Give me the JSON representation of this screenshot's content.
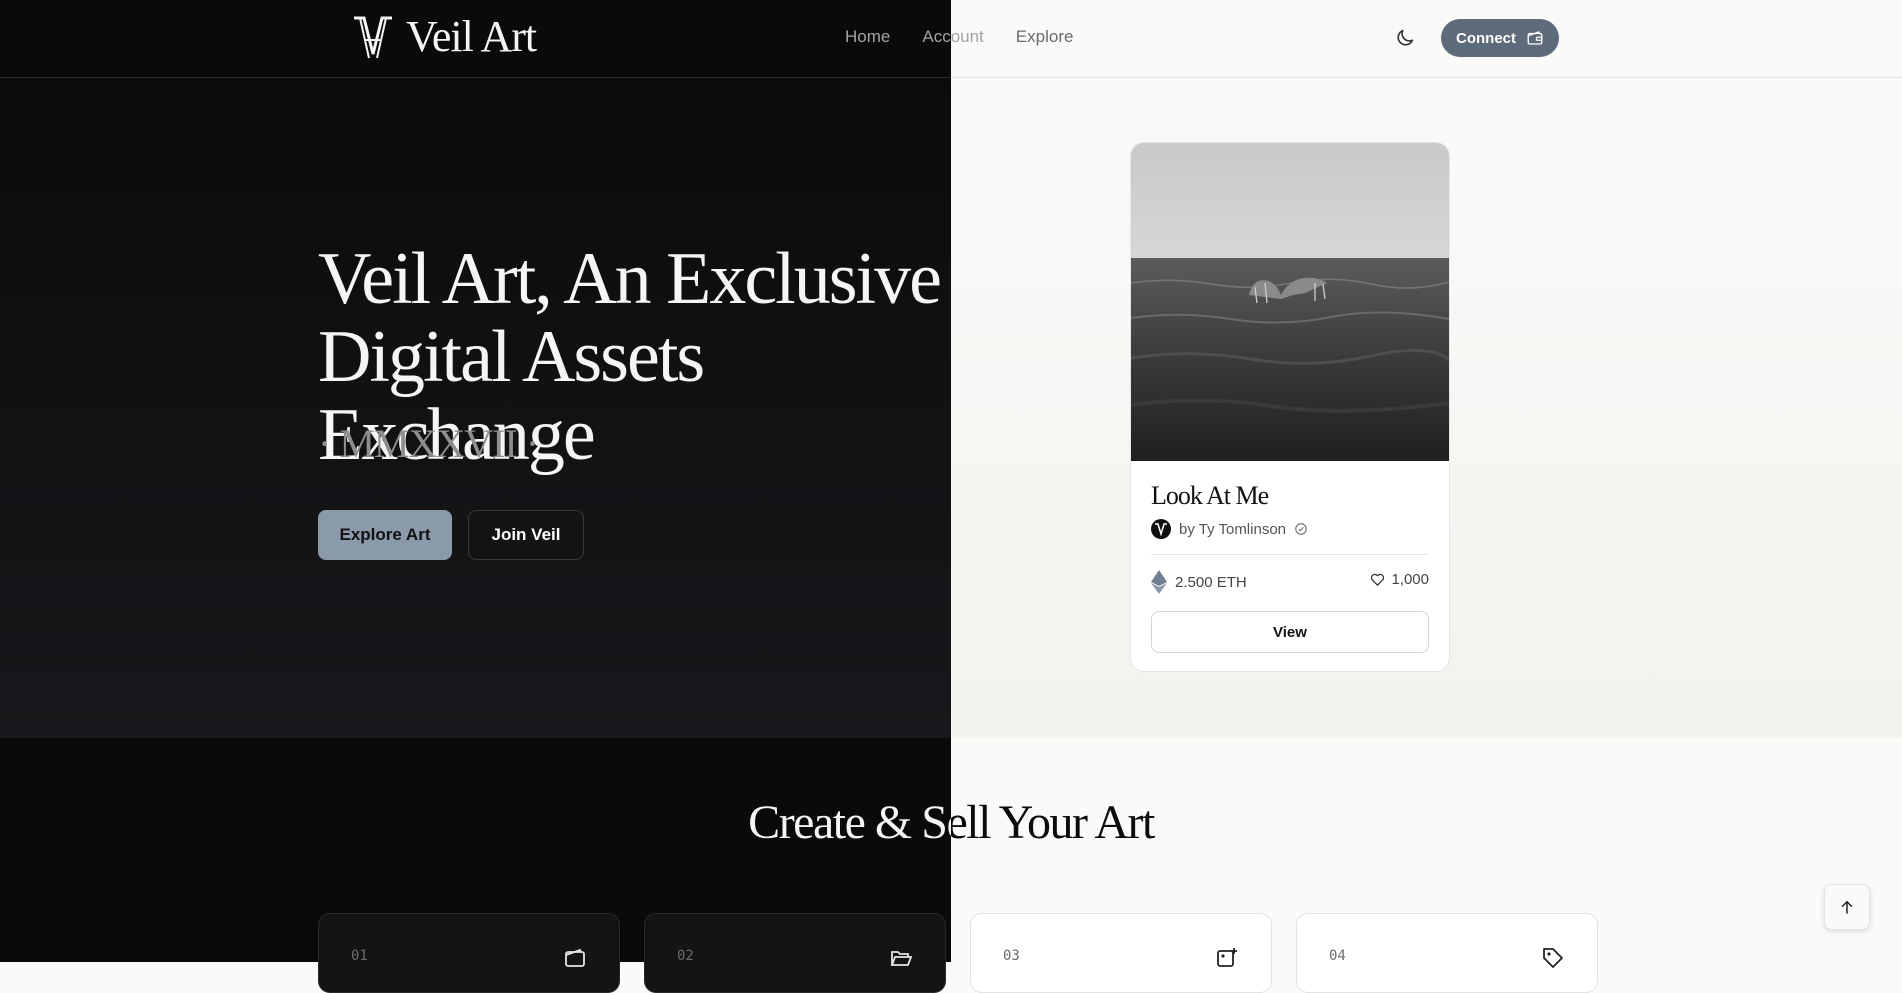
{
  "header": {
    "brand": "Veil Art",
    "nav": [
      {
        "label": "Home"
      },
      {
        "label": "Account"
      },
      {
        "label": "Explore"
      }
    ],
    "theme_toggle_icon": "moon-icon",
    "connect_label": "Connect",
    "connect_icon": "wallet-icon"
  },
  "hero": {
    "title": "Veil Art, An Exclusive Digital Assets Exchange",
    "year": "· MMXXVII ·",
    "explore_label": "Explore Art",
    "join_label": "Join Veil"
  },
  "featured_card": {
    "title": "Look At Me",
    "artist": "by Ty Tomlinson",
    "price": "2.500 ETH",
    "likes": "1,000",
    "view_label": "View",
    "image_subject": "whale tail in ocean, black and white"
  },
  "section": {
    "title": "Create & Sell Your Art",
    "steps": [
      {
        "number": "01",
        "icon": "wallet-icon"
      },
      {
        "number": "02",
        "icon": "folder-open-icon"
      },
      {
        "number": "03",
        "icon": "image-plus-icon"
      },
      {
        "number": "04",
        "icon": "tag-icon"
      }
    ]
  },
  "colors": {
    "dark_bg": "#0a0a0b",
    "light_bg": "#fafaf9",
    "accent": "#8a9aab",
    "connect_bg": "#5d6b7a"
  }
}
